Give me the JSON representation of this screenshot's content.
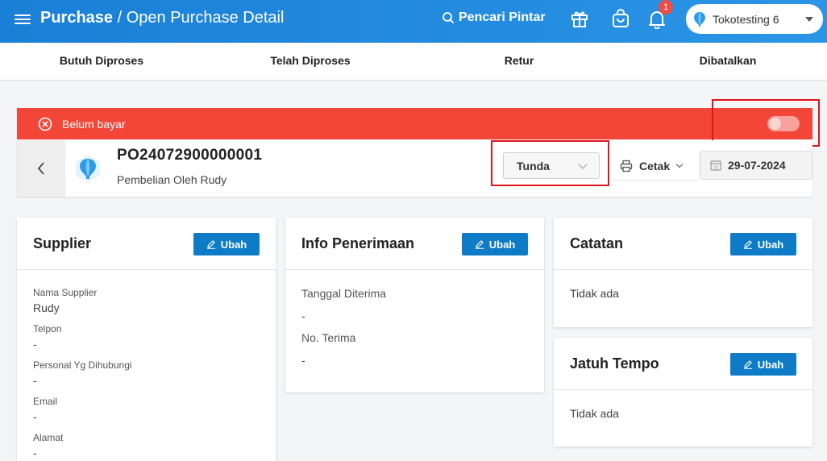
{
  "header": {
    "title_bold": "Purchase",
    "title_rest": " / Open Purchase Detail",
    "search_label": "Pencari Pintar",
    "notification_count": "1",
    "store_name": "Tokotesting 6"
  },
  "tabs": [
    {
      "label": "Butuh Diproses"
    },
    {
      "label": "Telah Diproses"
    },
    {
      "label": "Retur"
    },
    {
      "label": "Dibatalkan"
    }
  ],
  "banner": {
    "text": "Belum bayar",
    "paid_toggle_on": false
  },
  "po": {
    "number": "PO24072900000001",
    "subtitle": "Pembelian Oleh Rudy",
    "status": "Tunda",
    "print_label": "Cetak",
    "date": "29-07-2024"
  },
  "supplier": {
    "title": "Supplier",
    "edit_label": "Ubah",
    "fields": [
      {
        "label": "Nama Supplier",
        "value": "Rudy"
      },
      {
        "label": "Telpon",
        "value": "-"
      },
      {
        "label": "Personal Yg Dihubungi",
        "value": "-"
      },
      {
        "label": "Email",
        "value": "-"
      },
      {
        "label": "Alamat",
        "value": "-"
      }
    ]
  },
  "receipt": {
    "title": "Info Penerimaan",
    "edit_label": "Ubah",
    "fields": [
      {
        "label": "Tanggal Diterima",
        "value": "-"
      },
      {
        "label": "No. Terima",
        "value": "-"
      }
    ]
  },
  "notes": {
    "title": "Catatan",
    "edit_label": "Ubah",
    "value": "Tidak ada"
  },
  "due": {
    "title": "Jatuh Tempo",
    "edit_label": "Ubah",
    "value": "Tidak ada"
  },
  "colors": {
    "header_blue": "#1a7fd6",
    "banner_red": "#f24638",
    "button_blue": "#0e7bc6",
    "highlight_red": "#e0151b"
  }
}
